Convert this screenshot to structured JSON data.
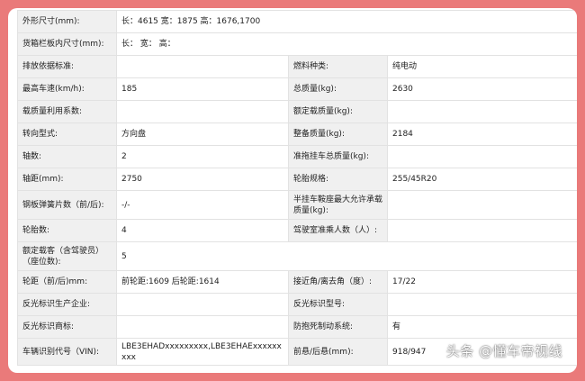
{
  "rows": [
    {
      "label": "外形尺寸(mm):",
      "value": "长：4615 宽：1875 高：1676,1700"
    },
    {
      "label": "货箱栏板内尺寸(mm):",
      "value": "长：  宽：  高："
    },
    {
      "label": "排放依据标准:",
      "value": "",
      "label2": "燃料种类:",
      "value2": "纯电动"
    },
    {
      "label": "最高车速(km/h):",
      "value": "185",
      "label2": "总质量(kg):",
      "value2": "2630"
    },
    {
      "label": "载质量利用系数:",
      "value": "",
      "label2": "额定载质量(kg):",
      "value2": ""
    },
    {
      "label": "转向型式:",
      "value": "方向盘",
      "label2": "整备质量(kg):",
      "value2": "2184"
    },
    {
      "label": "轴数:",
      "value": "2",
      "label2": "准拖挂车总质量(kg):",
      "value2": ""
    },
    {
      "label": "轴距(mm):",
      "value": "2750",
      "label2": "轮胎规格:",
      "value2": "255/45R20"
    },
    {
      "label": "钢板弹簧片数（前/后):",
      "value": "-/-",
      "label2": "半挂车鞍座最大允许承载质量(kg):",
      "value2": ""
    },
    {
      "label": "轮胎数:",
      "value": "4",
      "label2": "驾驶室准乘人数（人）:",
      "value2": ""
    },
    {
      "label": "额定载客（含驾驶员）（座位数):",
      "value": "5"
    },
    {
      "label": "轮距（前/后)mm:",
      "value": "前轮距:1609 后轮距:1614",
      "label2": "接近角/离去角（度）:",
      "value2": "17/22"
    },
    {
      "label": "反光标识生产企业:",
      "value": "",
      "label2": "反光标识型号:",
      "value2": ""
    },
    {
      "label": "反光标识商标:",
      "value": "",
      "label2": "防抱死制动系统:",
      "value2": "有"
    },
    {
      "label": "车辆识别代号（VIN):",
      "value": "LBE3EHADxxxxxxxxx,LBE3EHAExxxxxxxxx",
      "label2": "前悬/后悬(mm):",
      "value2": "918/947"
    }
  ],
  "watermark": "头条 @懂车帝视线"
}
